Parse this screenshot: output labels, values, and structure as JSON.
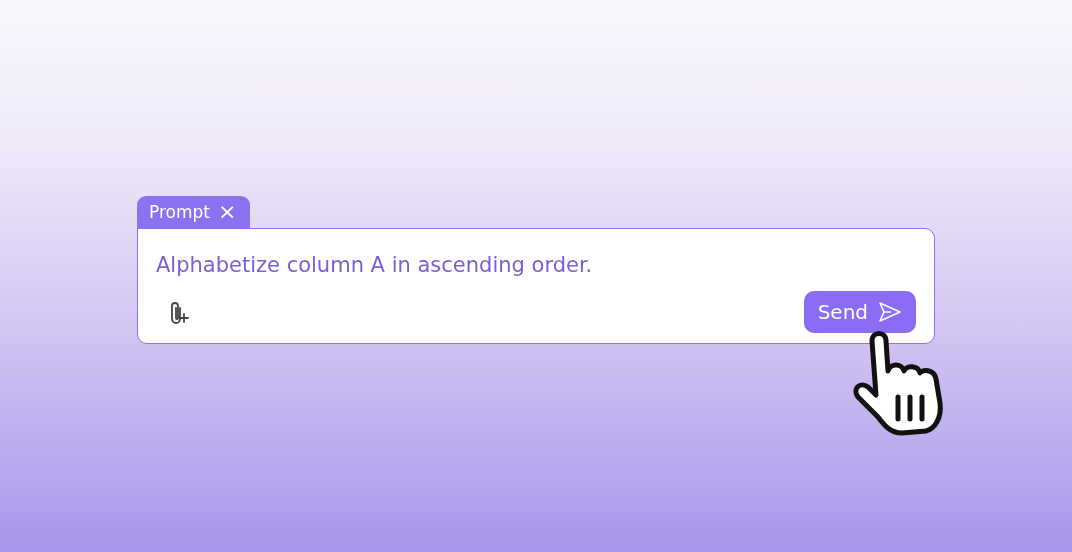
{
  "prompt_tab": {
    "label": "Prompt",
    "close": "×"
  },
  "prompt_field": {
    "value": "Alphabetize column A in ascending order."
  },
  "send_button": {
    "label": "Send"
  }
}
